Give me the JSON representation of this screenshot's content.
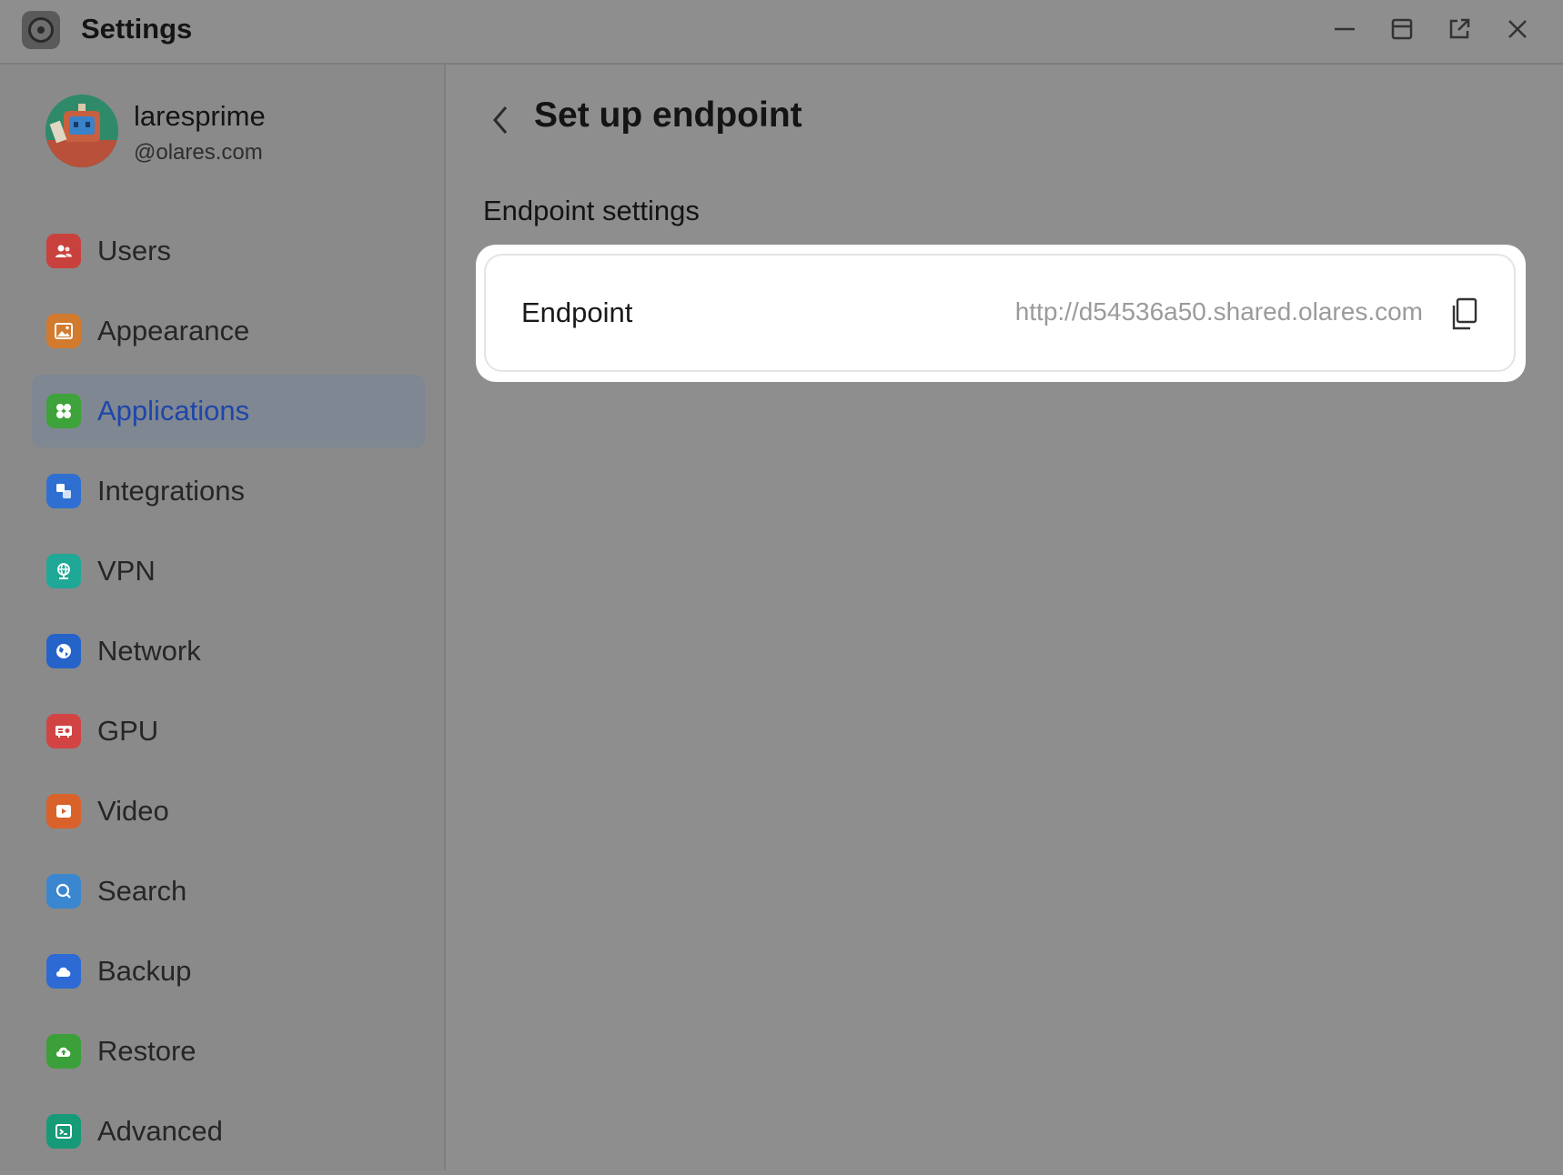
{
  "window": {
    "title": "Settings",
    "icon": "settings-gear-icon",
    "controls": [
      "minimize-icon",
      "maximize-icon",
      "open-external-icon",
      "close-icon"
    ]
  },
  "profile": {
    "name": "laresprime",
    "domain": "@olares.com"
  },
  "sidebar": {
    "items": [
      {
        "label": "Users",
        "icon": "users-icon",
        "color": "#c9413d"
      },
      {
        "label": "Appearance",
        "icon": "image-icon",
        "color": "#d27a2e"
      },
      {
        "label": "Applications",
        "icon": "apps-grid-icon",
        "color": "#3ea33a",
        "active": true
      },
      {
        "label": "Integrations",
        "icon": "integrations-icon",
        "color": "#2f6fd1"
      },
      {
        "label": "VPN",
        "icon": "vpn-globe-icon",
        "color": "#1fa896"
      },
      {
        "label": "Network",
        "icon": "network-icon",
        "color": "#2563c9"
      },
      {
        "label": "GPU",
        "icon": "gpu-icon",
        "color": "#d24444"
      },
      {
        "label": "Video",
        "icon": "video-play-icon",
        "color": "#d9622b"
      },
      {
        "label": "Search",
        "icon": "search-icon",
        "color": "#3b87cf"
      },
      {
        "label": "Backup",
        "icon": "cloud-backup-icon",
        "color": "#2e6ad4"
      },
      {
        "label": "Restore",
        "icon": "cloud-restore-icon",
        "color": "#3ba03a"
      },
      {
        "label": "Advanced",
        "icon": "terminal-icon",
        "color": "#179a78"
      }
    ]
  },
  "main": {
    "title": "Set up endpoint",
    "section_title": "Endpoint settings",
    "endpoint": {
      "label": "Endpoint",
      "value": "http://d54536a50.shared.olares.com"
    }
  }
}
